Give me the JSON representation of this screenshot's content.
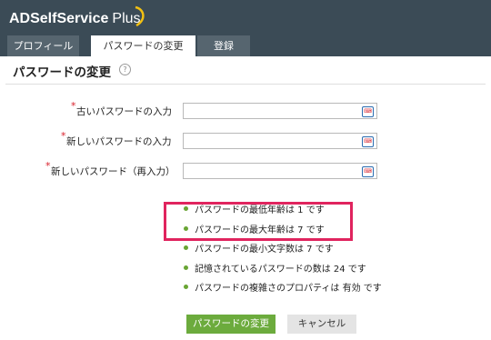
{
  "header": {
    "logo_main": "ADSelfService",
    "logo_plus": "Plus"
  },
  "tabs": [
    {
      "label": "プロフィール",
      "active": false
    },
    {
      "label": "パスワードの変更",
      "active": true
    },
    {
      "label": "登録",
      "active": false
    }
  ],
  "page": {
    "title": "パスワードの変更",
    "help_glyph": "?"
  },
  "form": {
    "required_mark": "*",
    "fields": [
      {
        "label": "古いパスワードの入力",
        "value": ""
      },
      {
        "label": "新しいパスワードの入力",
        "value": ""
      },
      {
        "label": "新しいパスワード（再入力）",
        "value": ""
      }
    ],
    "keyboard_icon": "virtual-keyboard-icon"
  },
  "policy_rules": [
    "パスワードの最低年齢は 1 です",
    "パスワードの最大年齢は 7 です",
    "パスワードの最小文字数は 7 です",
    "記憶されているパスワードの数は 24 です",
    "パスワードの複雑さのプロパティは 有効 です"
  ],
  "buttons": {
    "submit": "パスワードの変更",
    "cancel": "キャンセル"
  },
  "colors": {
    "header_bg": "#3b4b56",
    "tab_bg": "#56656f",
    "accent_green": "#6cab3d",
    "highlight": "#e0245e",
    "required": "#d9212c"
  }
}
